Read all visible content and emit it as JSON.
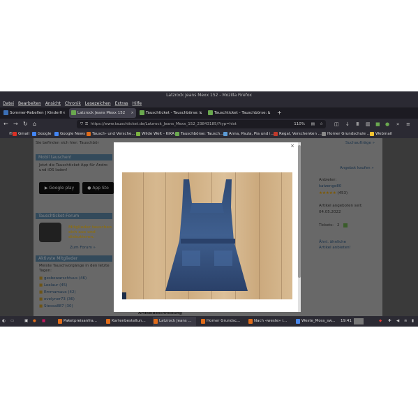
{
  "window": {
    "title": "Latzrock Jeans Mexx 152 - Mozilla Firefox"
  },
  "menu": [
    "Datei",
    "Bearbeiten",
    "Ansicht",
    "Chronik",
    "Lesezeichen",
    "Extras",
    "Hilfe"
  ],
  "tabs": [
    {
      "label": "Sommer-Rebellen | Kinderfi",
      "color": "#3b6fb6"
    },
    {
      "label": "Latzrock Jeans Mexx 152",
      "color": "#6aa84f"
    },
    {
      "label": "Tauschticket - Tauschbörse: L",
      "color": "#6aa84f"
    },
    {
      "label": "Tauschticket - Tauschbörse: L",
      "color": "#6aa84f"
    }
  ],
  "address": {
    "url": "https://www.tauschticket.de/Latzrock_Jeans_Mexx_152_23843185/?typ=hist",
    "zoom": "110%"
  },
  "bookmarks": [
    {
      "label": "Gmail",
      "color": "#d93025"
    },
    {
      "label": "Google",
      "color": "#4285f4"
    },
    {
      "label": "Google News",
      "color": "#4285f4"
    },
    {
      "label": "Tausch- und Versche...",
      "color": "#e06c1a"
    },
    {
      "label": "Wilde Welt - KiKA",
      "color": "#7cb342"
    },
    {
      "label": "Tauschbörse: Tausch...",
      "color": "#6aa84f"
    },
    {
      "label": "Anna, Paula, Pia und i...",
      "color": "#5b9bd5"
    },
    {
      "label": "Regal, Verschenken ...",
      "color": "#c0392b"
    },
    {
      "label": "Homer Grundschule ...",
      "color": "#888888"
    },
    {
      "label": "Webmail",
      "color": "#f1c232"
    }
  ],
  "page": {
    "breadcrumb": "Sie befinden sich hier: Tauschbör",
    "search_link": "Suchaufträge »",
    "similar_link": "Angebot kaufen »",
    "mobile_title": "Mobil tauschen!",
    "mobile_text_1": "Jetzt die Tauschticket App für Andro",
    "mobile_text_2": "und iOS laden!",
    "google_play": "Google play",
    "app_store": "App Sto",
    "forum_title": "Tauschticket-Forum",
    "forum_text_1": "Mitglieder tauschen",
    "forum_text_2": "sich aus und",
    "forum_text_3": "diskutieren.",
    "forum_link": "Zum Forum »",
    "active_title": "Aktivste Mitglieder",
    "active_text_1": "Meiste Tauschvorgänge in den letzte",
    "active_text_2": "Tagen:",
    "members": [
      "gesbewarschtuus (46)",
      "Leelaur (45)",
      "Emmamaus (42)",
      "evelyner73 (36)",
      "Stessa887 (30)"
    ],
    "seller_label": "Anbieter:",
    "seller_name": "katzenge80",
    "seller_rating": "(453)",
    "offered_label": "Artikel angeboten seit:",
    "offered_date": "04.05.2022",
    "tickets_label": "Tickets:",
    "tickets_value": "2",
    "similar_1": "Ähnl. ähnliche",
    "similar_2": "Artikel anbieten!",
    "bottom_text": "Artikelbeschreibung"
  },
  "modal": {
    "close": "×"
  },
  "taskbar": {
    "items": [
      {
        "label": "Paketpreisanfra...",
        "color": "#e06c1a"
      },
      {
        "label": "Kartenbestellun...",
        "color": "#e06c1a"
      },
      {
        "label": "Latzrock Jeans ...",
        "color": "#e06c1a"
      },
      {
        "label": "Homer Grundsc...",
        "color": "#e06c1a"
      },
      {
        "label": "Nach «weste» i...",
        "color": "#e06c1a"
      },
      {
        "label": "Weste_Moss_sw...",
        "color": "#4a86e8"
      }
    ],
    "time": "19:41"
  }
}
